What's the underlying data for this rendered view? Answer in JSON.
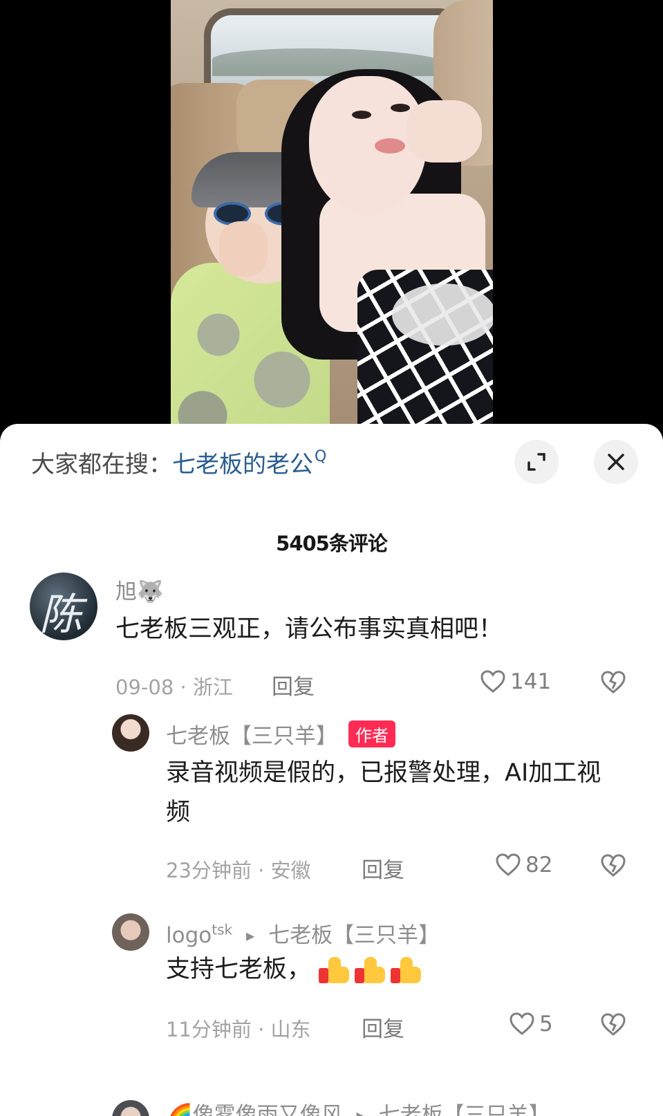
{
  "search": {
    "prefix": "大家都在搜：",
    "term": "七老板的老公",
    "search_glyph": "Q"
  },
  "comment_count": "5405条评论",
  "comments": [
    {
      "name": "旭🐺",
      "text": "七老板三观正，请公布事实真相吧！",
      "meta": "09-08 · 浙江",
      "reply": "回复",
      "likes": "141",
      "avatar_char": "陈"
    },
    {
      "name": "七老板【三只羊】",
      "badge": "作者",
      "text": "录音视频是假的，已报警处理，AI加工视频",
      "meta": "23分钟前 · 安徽",
      "reply": "回复",
      "likes": "82"
    },
    {
      "name": "logo",
      "name_sup": "tsk",
      "reply_to": "七老板【三只羊】",
      "text": "支持七老板，",
      "meta": "11分钟前 · 山东",
      "reply": "回复",
      "likes": "5"
    },
    {
      "name": "🌈像雾像雨又像风",
      "reply_to": "七老板【三只羊】"
    }
  ],
  "icons": {
    "expand": "expand-icon",
    "close": "close-icon",
    "like": "heart-outline-icon",
    "dislike": "broken-heart-icon",
    "reply_arrow": "triangle-right-icon",
    "thumbs_up": "thumbs-up-emoji"
  }
}
